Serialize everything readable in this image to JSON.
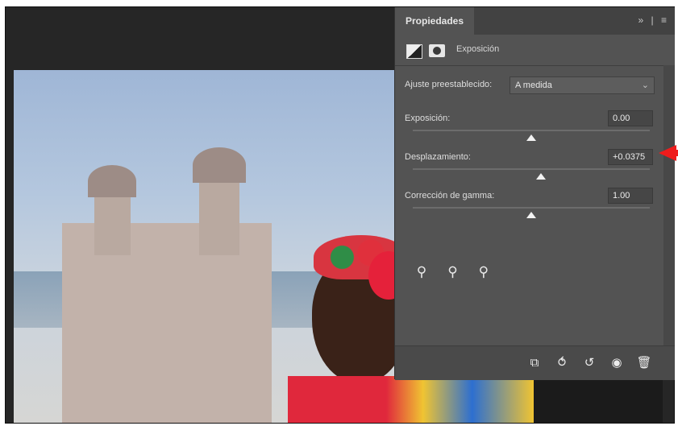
{
  "panel": {
    "tab_title": "Propiedades",
    "header_controls": [
      "»",
      "|",
      "≡"
    ],
    "subtitle": "Exposición"
  },
  "preset": {
    "label": "Ajuste preestablecido:",
    "value": "A medida"
  },
  "sliders": [
    {
      "label": "Exposición:",
      "value": "0.00",
      "level": 0.5
    },
    {
      "label": "Desplazamiento:",
      "value": "+0.0375",
      "level": 0.54
    },
    {
      "label": "Corrección de gamma:",
      "value": "1.00",
      "level": 0.5
    }
  ],
  "eyedroppers": [
    "eyedropper-black-icon",
    "eyedropper-gray-icon",
    "eyedropper-white-icon"
  ],
  "footer_buttons": [
    {
      "name": "clip-to-layer-icon",
      "glyph": "⧉"
    },
    {
      "name": "view-previous-state-icon",
      "glyph": "⥀"
    },
    {
      "name": "reset-icon",
      "glyph": "↺"
    },
    {
      "name": "visibility-icon",
      "glyph": "◉"
    },
    {
      "name": "delete-icon",
      "glyph": "🗑"
    }
  ],
  "colors": {
    "panel_bg": "#535353",
    "accent_arrow": "#ee1c1c"
  }
}
